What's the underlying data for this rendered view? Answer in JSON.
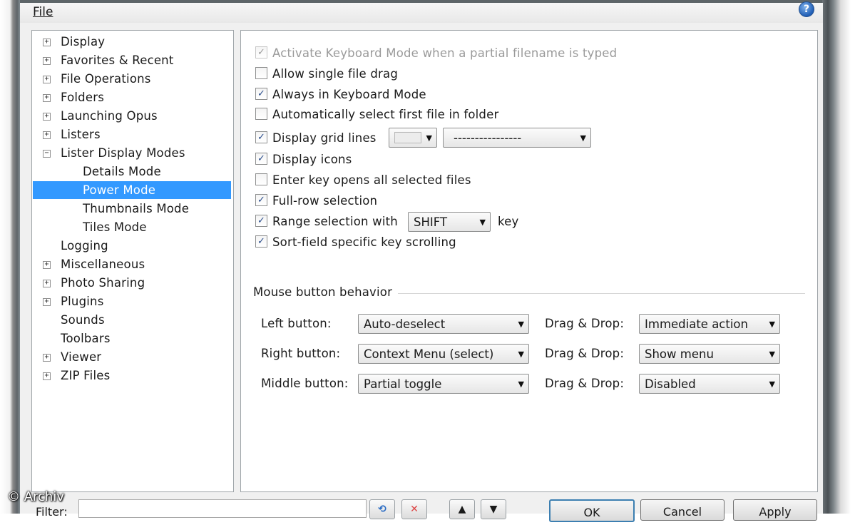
{
  "menubar": {
    "file": "File",
    "help_icon": "?"
  },
  "tree": {
    "items": [
      {
        "label": "Display",
        "expander": "+"
      },
      {
        "label": "Favorites & Recent",
        "expander": "+"
      },
      {
        "label": "File Operations",
        "expander": "+"
      },
      {
        "label": "Folders",
        "expander": "+"
      },
      {
        "label": "Launching Opus",
        "expander": "+"
      },
      {
        "label": "Listers",
        "expander": "+"
      },
      {
        "label": "Lister Display Modes",
        "expander": "−"
      },
      {
        "label": "Details Mode"
      },
      {
        "label": "Power Mode",
        "selected": true
      },
      {
        "label": "Thumbnails Mode"
      },
      {
        "label": "Tiles Mode"
      },
      {
        "label": "Logging"
      },
      {
        "label": "Miscellaneous",
        "expander": "+"
      },
      {
        "label": "Photo Sharing",
        "expander": "+"
      },
      {
        "label": "Plugins",
        "expander": "+"
      },
      {
        "label": "Sounds"
      },
      {
        "label": "Toolbars"
      },
      {
        "label": "Viewer",
        "expander": "+"
      },
      {
        "label": "ZIP Files",
        "expander": "+"
      }
    ]
  },
  "options": {
    "activate_keyboard": {
      "label": "Activate Keyboard Mode when a partial filename is typed",
      "checked": true,
      "disabled": true
    },
    "single_file_drag": {
      "label": "Allow single file drag",
      "checked": false
    },
    "always_keyboard": {
      "label": "Always in Keyboard Mode",
      "checked": true
    },
    "auto_select_first": {
      "label": "Automatically select first file in folder",
      "checked": false
    },
    "grid_lines": {
      "label": "Display grid lines",
      "checked": true,
      "line_style": "----------------"
    },
    "display_icons": {
      "label": "Display icons",
      "checked": true
    },
    "enter_opens_all": {
      "label": "Enter key opens all selected files",
      "checked": false
    },
    "full_row": {
      "label": "Full-row selection",
      "checked": true
    },
    "range_selection": {
      "label": "Range selection with",
      "checked": true,
      "key_value": "SHIFT",
      "suffix": "key"
    },
    "sort_field_scroll": {
      "label": "Sort-field specific key scrolling",
      "checked": true
    },
    "check_glyph": "✓"
  },
  "mouse": {
    "group_title": "Mouse button behavior",
    "left_label": "Left button:",
    "left_value": "Auto-deselect",
    "right_label": "Right button:",
    "right_value": "Context Menu (select)",
    "middle_label": "Middle button:",
    "middle_value": "Partial toggle",
    "dnd_label": "Drag & Drop:",
    "left_dnd": "Immediate action",
    "right_dnd": "Show menu",
    "middle_dnd": "Disabled"
  },
  "bottom": {
    "filter_label": "Filter:",
    "ok": "OK",
    "cancel": "Cancel",
    "apply": "Apply"
  },
  "watermark": "© Archiv",
  "arrow_glyph": "▼"
}
